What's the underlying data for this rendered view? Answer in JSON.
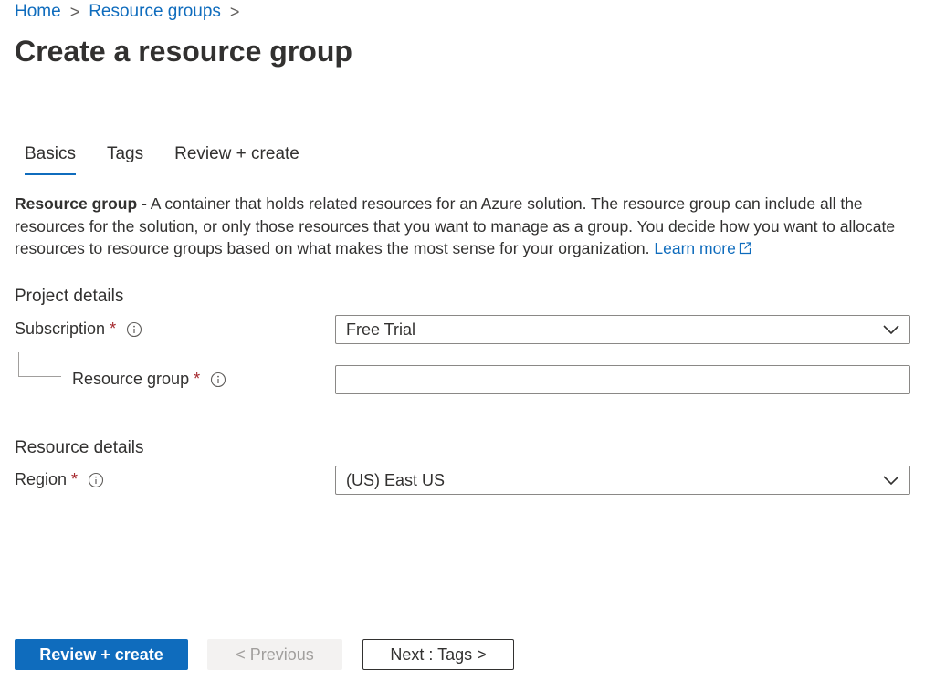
{
  "breadcrumb": {
    "items": [
      "Home",
      "Resource groups"
    ],
    "separator": ">"
  },
  "page": {
    "title": "Create a resource group"
  },
  "tabs": [
    {
      "label": "Basics",
      "active": true
    },
    {
      "label": "Tags",
      "active": false
    },
    {
      "label": "Review + create",
      "active": false
    }
  ],
  "description": {
    "term": "Resource group",
    "text": " - A container that holds related resources for an Azure solution. The resource group can include all the resources for the solution, or only those resources that you want to manage as a group. You decide how you want to allocate resources to resource groups based on what makes the most sense for your organization. ",
    "link_label": "Learn more"
  },
  "project_details": {
    "title": "Project details",
    "subscription": {
      "label": "Subscription",
      "required": "*",
      "value": "Free Trial"
    },
    "resource_group": {
      "label": "Resource group",
      "required": "*",
      "value": "",
      "placeholder": ""
    }
  },
  "resource_details": {
    "title": "Resource details",
    "region": {
      "label": "Region",
      "required": "*",
      "value": "(US) East US"
    }
  },
  "footer": {
    "review_create_label": "Review + create",
    "previous_label": "< Previous",
    "next_label": "Next : Tags >"
  },
  "colors": {
    "accent": "#0f6cbd",
    "required": "#a4262c",
    "text": "#323130",
    "disabled_bg": "#f3f2f1",
    "disabled_text": "#a19f9d"
  },
  "icons": {
    "info": "info-icon",
    "external_link": "external-link-icon",
    "dropdown": "chevron-down-icon"
  }
}
